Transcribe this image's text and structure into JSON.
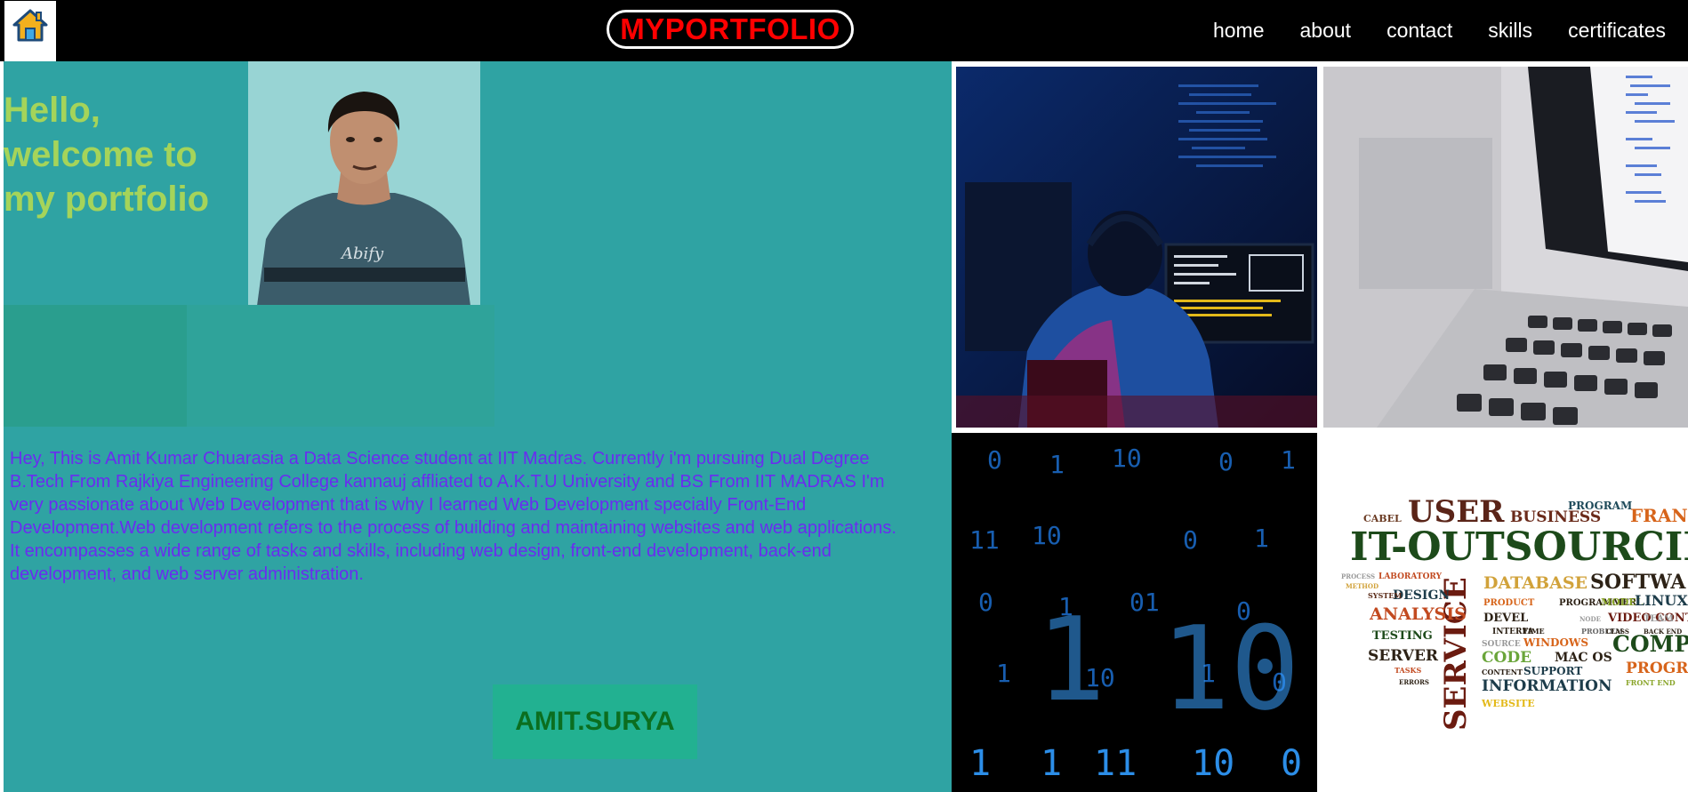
{
  "header": {
    "brand": "MYPORTFOLIO",
    "home_icon": "home-icon",
    "nav": [
      {
        "label": "home"
      },
      {
        "label": "about"
      },
      {
        "label": "contact"
      },
      {
        "label": "skills"
      },
      {
        "label": "certificates"
      }
    ]
  },
  "hero": {
    "greeting_line1": "Hello,",
    "greeting_line2": "welcome to",
    "greeting_line3": "my portfolio",
    "photo_caption": "Abify",
    "bio": "Hey, This is Amit Kumar Chuarasia a Data Science student at IIT Madras. Currently i'm pursuing Dual Degree B.Tech From Rajkiya Engineering College kannauj affliated to A.K.T.U University and BS From IIT MADRAS I'm very passionate about Web Development that is why I learned Web Development specially Front-End Development.Web development refers to the process of building and maintaining websites and web applications. It encompasses a wide range of tasks and skills, including web design, front-end development, back-end development, and web server administration.",
    "signature": "AMIT.SURYA"
  },
  "colors": {
    "header_bg": "#000000",
    "brand_text": "#ff0000",
    "panel_bg": "#2fa3a3",
    "greeting": "#a5d45a",
    "bio_text": "#6a2cf0",
    "signature_text": "#0b6e1f"
  },
  "wordcloud": {
    "words": [
      "USER",
      "BUSINESS",
      "PROGRAM",
      "CABEL",
      "FRANC",
      "IT-OUTSOURCIN",
      "DATABASE",
      "SOFTWA",
      "SERVICE",
      "DESIGN",
      "SYSTEM",
      "PRODUCT",
      "PROGRAMMER",
      "MODEL",
      "LINUX",
      "DEVEL",
      "VIDEO CONTROL",
      "TEAM",
      "INTERFA",
      "TIME",
      "PROBLEM",
      "CLASS",
      "BACK END",
      "ANALYSIS",
      "TESTING",
      "WINDOWS",
      "SOURCE",
      "COMPU",
      "SERVER",
      "CODE",
      "MAC OS",
      "CONTENT",
      "SUPPORT",
      "PROGR",
      "TASKS",
      "INFORMATION",
      "FRONT END",
      "ERRORS",
      "WEBSITE",
      "LABORATORY",
      "PROCESS",
      "METHOD",
      "NODE"
    ]
  },
  "matrix_digits": [
    "0",
    "1",
    "10",
    "0",
    "1",
    "11",
    "10",
    "0",
    "1",
    "0",
    "1",
    "01",
    "0",
    "1",
    "10",
    "1",
    "0",
    "1",
    "10",
    "1"
  ]
}
